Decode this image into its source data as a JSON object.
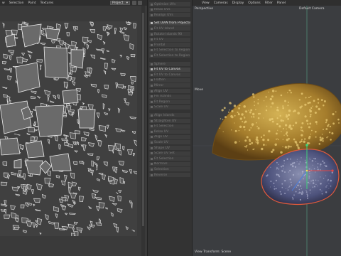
{
  "uv_editor": {
    "menu": [
      "w",
      "Selection",
      "Paint",
      "Textures"
    ],
    "project_select": "Project"
  },
  "commands": [
    {
      "label": "Optimize UVs",
      "active": false
    },
    {
      "label": "Relax UVs",
      "active": false
    },
    {
      "label": "Realign UVs",
      "active": false
    },
    {
      "label": "Set UVW from Projection",
      "active": true
    },
    {
      "label": "Fit UV Island",
      "active": false
    },
    {
      "label": "Rotate Islands 90",
      "active": false
    },
    {
      "label": "Fit UV",
      "active": false
    },
    {
      "label": "Frontal",
      "active": false
    },
    {
      "label": "Fit Selection to Region",
      "active": false
    },
    {
      "label": "Fit Selection to Region",
      "active": false
    },
    {
      "label": "Sphere",
      "active": false
    },
    {
      "label": "Fit UV to Canvas",
      "active": true
    },
    {
      "label": "Fit UV to Canvas",
      "active": false
    },
    {
      "label": "Flatten",
      "active": false
    },
    {
      "label": "Mirror",
      "active": false
    },
    {
      "label": "Align UV",
      "active": false
    },
    {
      "label": "Pin Islands",
      "active": false
    },
    {
      "label": "Fit Region",
      "active": false
    },
    {
      "label": "Scale UV",
      "active": false
    },
    {
      "label": "Align Islands",
      "active": false
    },
    {
      "label": "Straighten UV",
      "active": false
    },
    {
      "label": "Fit Selection",
      "active": false
    },
    {
      "label": "Relax UV",
      "active": false
    },
    {
      "label": "Align UV",
      "active": false
    },
    {
      "label": "Scale UV",
      "active": false
    },
    {
      "label": "Shape UV",
      "active": false
    },
    {
      "label": "Scale UV Set",
      "active": false
    },
    {
      "label": "Fit Selection",
      "active": false
    },
    {
      "label": "Normals",
      "active": false
    },
    {
      "label": "Selection",
      "active": false
    },
    {
      "label": "Reverse",
      "active": false
    }
  ],
  "viewport": {
    "menu": [
      "View",
      "Cameras",
      "Display",
      "Options",
      "Filter",
      "Panel"
    ],
    "view_name": "Perspective",
    "camera_name": "Default Camera",
    "move_label": "Move",
    "transform_label": "View Transform: Scene"
  },
  "colors": {
    "panel_bg": "#333333",
    "uv_bg": "#3a3a3a",
    "viewport_bg": "#3b3d40",
    "mesh_top": "#b8913a",
    "mesh_bottom": "#5a5f8a",
    "selection": "#e05a3c"
  }
}
